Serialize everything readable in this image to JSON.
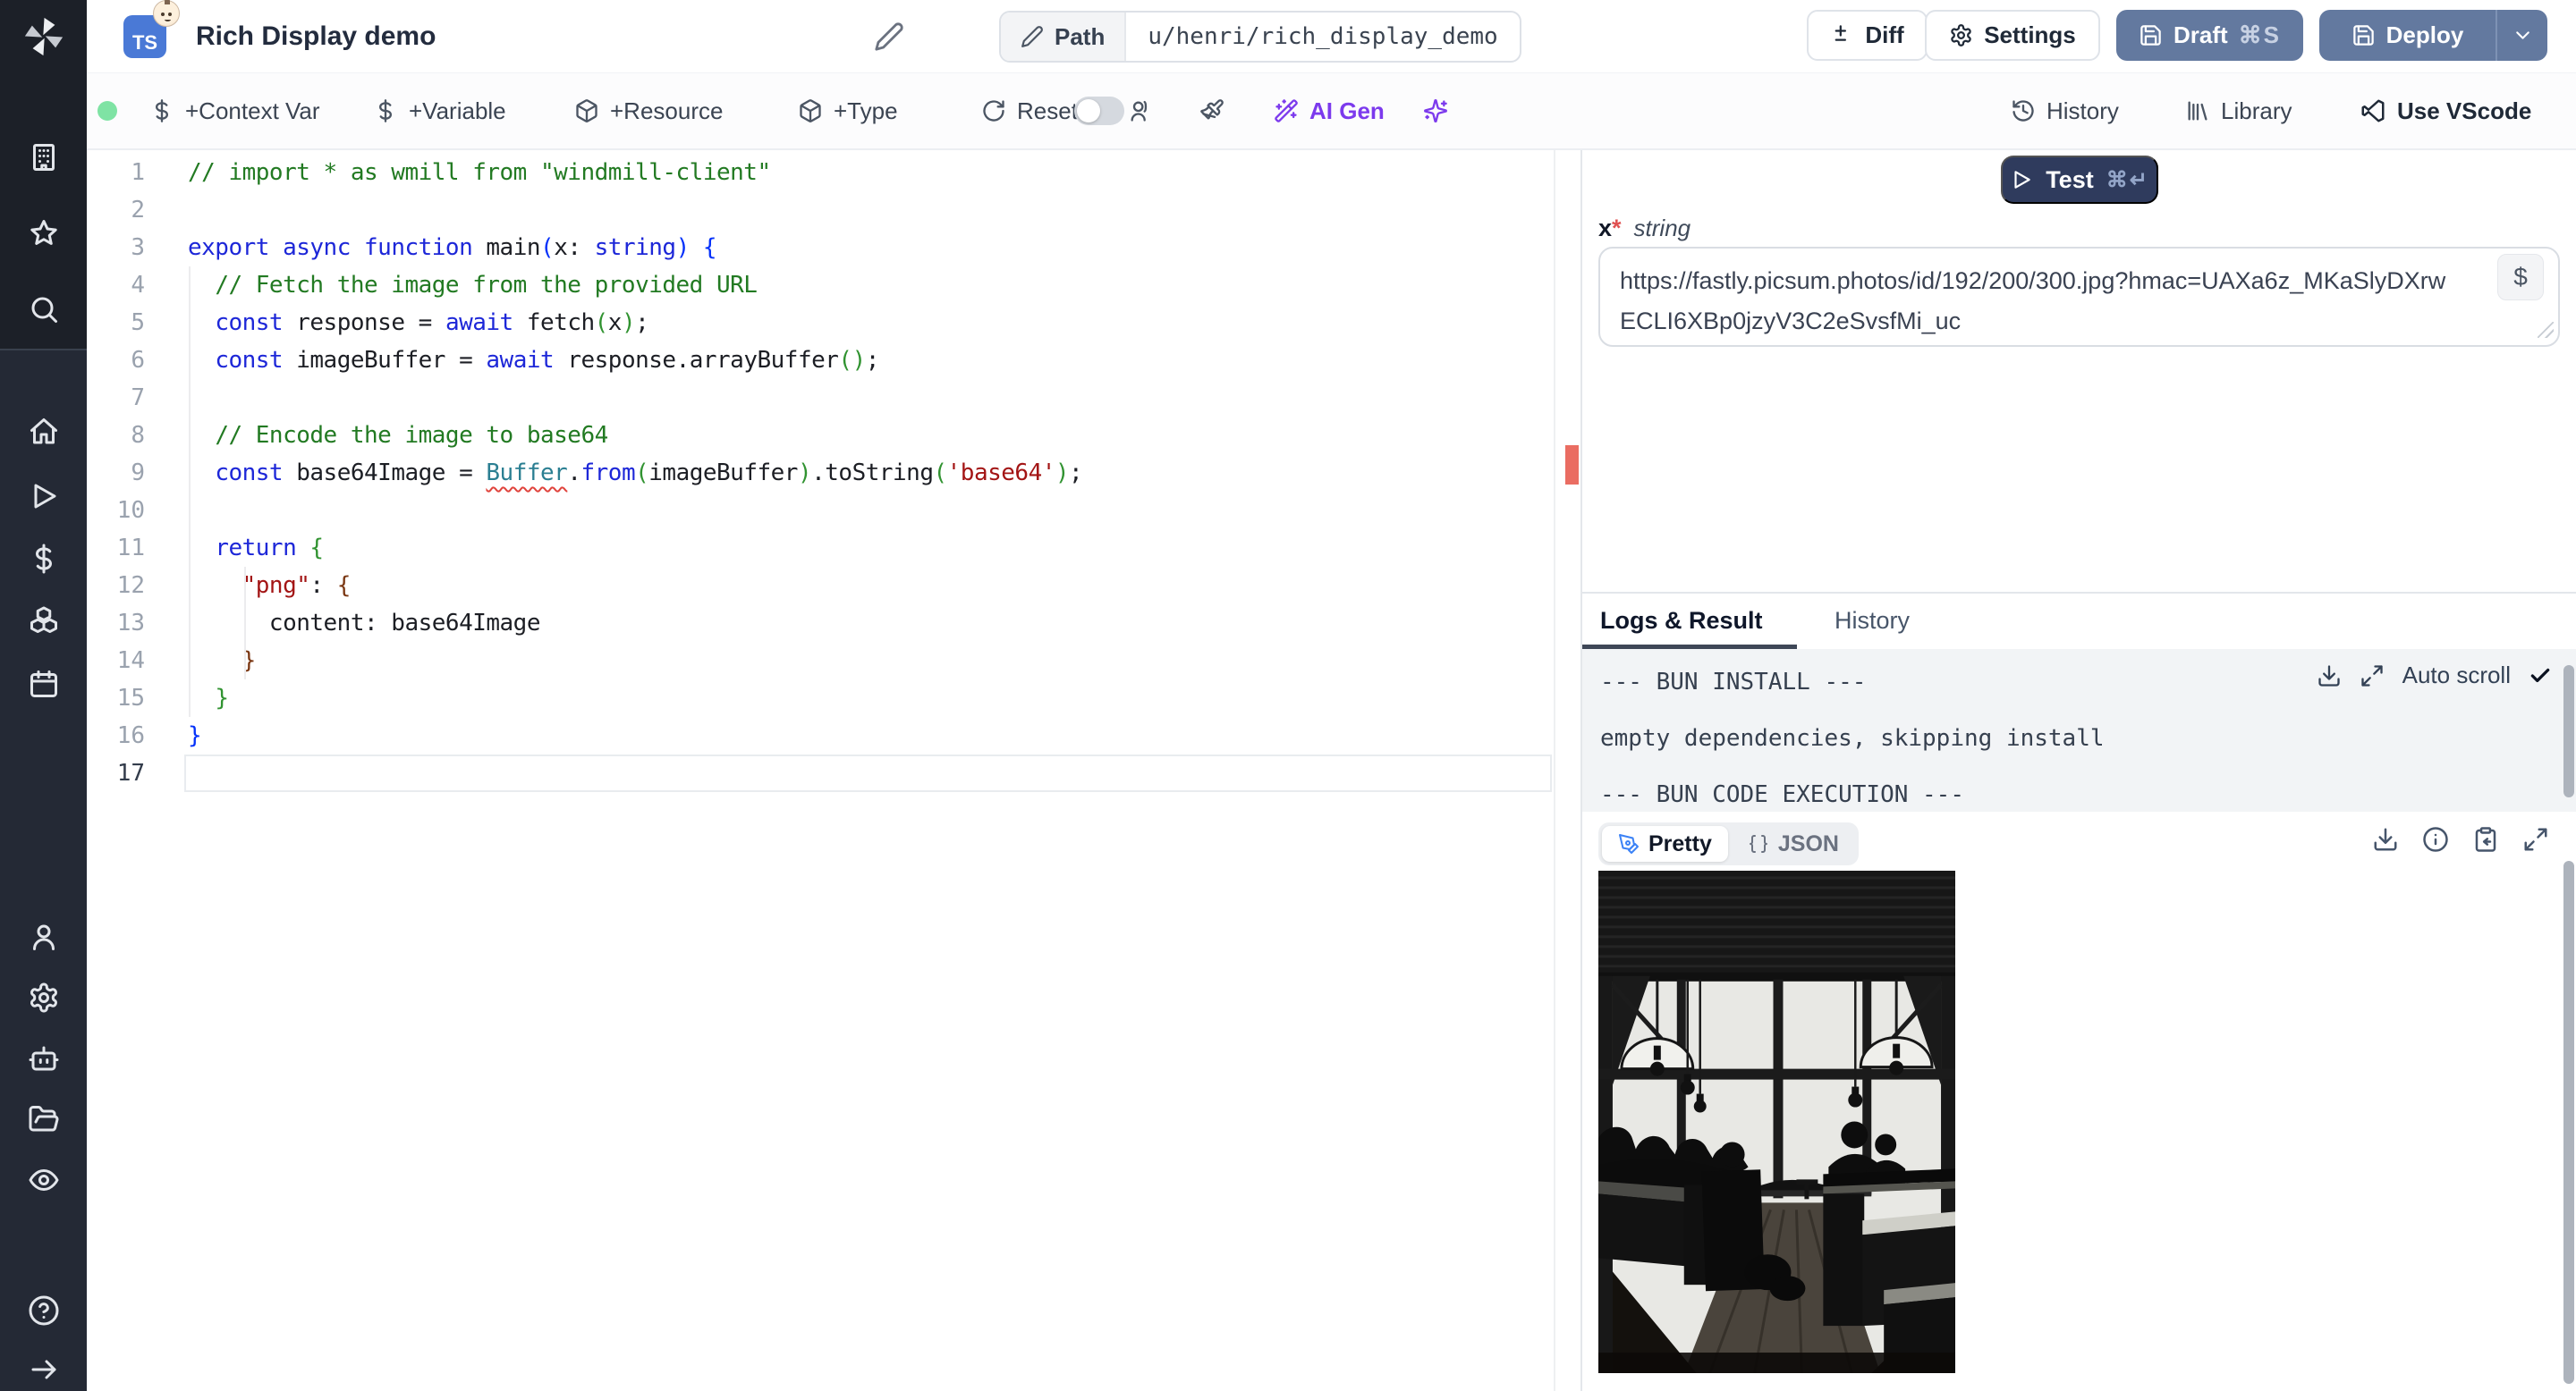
{
  "header": {
    "badge": "TS",
    "title": "Rich Display demo",
    "path_label": "Path",
    "path_value": "u/henri/rich_display_demo",
    "diff": "Diff",
    "settings": "Settings",
    "draft": "Draft",
    "draft_kbd": "⌘S",
    "deploy": "Deploy"
  },
  "toolbar": {
    "status_dot_color": "#7fe3a4",
    "context_var": "+Context Var",
    "variable": "+Variable",
    "resource": "+Resource",
    "type": "+Type",
    "reset": "Reset",
    "ai_gen": "AI Gen",
    "history": "History",
    "library": "Library",
    "vscode": "Use VScode",
    "accent_purple": "#7c3aed"
  },
  "sidebar": {
    "top_icons": [
      {
        "name": "building-icon",
        "icon": "building"
      },
      {
        "name": "star-icon",
        "icon": "star"
      },
      {
        "name": "search-icon",
        "icon": "search"
      }
    ],
    "mid_icons": [
      {
        "name": "home-icon",
        "icon": "home"
      },
      {
        "name": "runs-play-icon",
        "icon": "play"
      },
      {
        "name": "variables-dollar-icon",
        "icon": "dollar"
      },
      {
        "name": "resources-boxes-icon",
        "icon": "boxes"
      },
      {
        "name": "schedules-calendar-icon",
        "icon": "calendar"
      }
    ],
    "lower_icons": [
      {
        "name": "user-icon",
        "icon": "user"
      },
      {
        "name": "settings-gear-icon",
        "icon": "gear"
      },
      {
        "name": "workers-bot-icon",
        "icon": "bot"
      },
      {
        "name": "folders-icon",
        "icon": "folder"
      },
      {
        "name": "audit-eye-icon",
        "icon": "eye"
      }
    ],
    "footer_icons": [
      {
        "name": "help-icon",
        "icon": "help"
      },
      {
        "name": "expand-arrow-icon",
        "icon": "arrow-right"
      }
    ]
  },
  "editor": {
    "active_line": 17,
    "error_marker_color": "#ea6d62",
    "lines": [
      {
        "n": 1,
        "tokens": [
          [
            "cmt",
            "// import * as wmill from \"windmill-client\""
          ]
        ]
      },
      {
        "n": 2,
        "tokens": []
      },
      {
        "n": 3,
        "tokens": [
          [
            "kw",
            "export"
          ],
          [
            "pl",
            " "
          ],
          [
            "kw",
            "async"
          ],
          [
            "pl",
            " "
          ],
          [
            "kw",
            "function"
          ],
          [
            "pl",
            " main"
          ],
          [
            "b0",
            "("
          ],
          [
            "pl",
            "x: "
          ],
          [
            "kw",
            "string"
          ],
          [
            "b0",
            ")"
          ],
          [
            "pl",
            " "
          ],
          [
            "b0",
            "{"
          ]
        ]
      },
      {
        "n": 4,
        "tokens": [
          [
            "pl",
            "  "
          ],
          [
            "cmt",
            "// Fetch the image from the provided URL"
          ]
        ]
      },
      {
        "n": 5,
        "tokens": [
          [
            "pl",
            "  "
          ],
          [
            "kw",
            "const"
          ],
          [
            "pl",
            " response = "
          ],
          [
            "kw",
            "await"
          ],
          [
            "pl",
            " fetch"
          ],
          [
            "b1",
            "("
          ],
          [
            "pl",
            "x"
          ],
          [
            "b1",
            ")"
          ],
          [
            "pl",
            ";"
          ]
        ]
      },
      {
        "n": 6,
        "tokens": [
          [
            "pl",
            "  "
          ],
          [
            "kw",
            "const"
          ],
          [
            "pl",
            " imageBuffer = "
          ],
          [
            "kw",
            "await"
          ],
          [
            "pl",
            " response.arrayBuffer"
          ],
          [
            "b1",
            "("
          ],
          [
            "b1",
            ")"
          ],
          [
            "pl",
            ";"
          ]
        ]
      },
      {
        "n": 7,
        "tokens": []
      },
      {
        "n": 8,
        "tokens": [
          [
            "pl",
            "  "
          ],
          [
            "cmt",
            "// Encode the image to base64"
          ]
        ]
      },
      {
        "n": 9,
        "tokens": [
          [
            "pl",
            "  "
          ],
          [
            "kw",
            "const"
          ],
          [
            "pl",
            " base64Image = "
          ],
          [
            "sq",
            "Buffer"
          ],
          [
            "pl",
            "."
          ],
          [
            "kw",
            "from"
          ],
          [
            "b1",
            "("
          ],
          [
            "pl",
            "imageBuffer"
          ],
          [
            "b1",
            ")"
          ],
          [
            "pl",
            ".toString"
          ],
          [
            "b1",
            "("
          ],
          [
            "str",
            "'base64'"
          ],
          [
            "b1",
            ")"
          ],
          [
            "pl",
            ";"
          ]
        ]
      },
      {
        "n": 10,
        "tokens": []
      },
      {
        "n": 11,
        "tokens": [
          [
            "pl",
            "  "
          ],
          [
            "kw",
            "return"
          ],
          [
            "pl",
            " "
          ],
          [
            "b1",
            "{"
          ]
        ]
      },
      {
        "n": 12,
        "tokens": [
          [
            "pl",
            "    "
          ],
          [
            "str",
            "\"png\""
          ],
          [
            "pl",
            ": "
          ],
          [
            "b2",
            "{"
          ]
        ]
      },
      {
        "n": 13,
        "tokens": [
          [
            "pl",
            "      content: base64Image"
          ]
        ]
      },
      {
        "n": 14,
        "tokens": [
          [
            "pl",
            "    "
          ],
          [
            "b2",
            "}"
          ]
        ]
      },
      {
        "n": 15,
        "tokens": [
          [
            "pl",
            "  "
          ],
          [
            "b1",
            "}"
          ]
        ]
      },
      {
        "n": 16,
        "tokens": [
          [
            "b0",
            "}"
          ]
        ]
      },
      {
        "n": 17,
        "tokens": []
      }
    ]
  },
  "panel": {
    "test": "Test",
    "test_kbd": "⌘↵",
    "arg": {
      "name": "x",
      "required_mark": "*",
      "type": "string",
      "value": "https://fastly.picsum.photos/id/192/200/300.jpg?hmac=UAXa6z_MKaSlyDXrwECLI6XBp0jzyV3C2eSvsfMi_uc",
      "dollar": "$"
    },
    "tabs": {
      "logs": "Logs & Result",
      "history": "History"
    },
    "auto_scroll": "Auto scroll",
    "logs": [
      "--- BUN INSTALL ---",
      "empty dependencies, skipping install",
      "--- BUN CODE EXECUTION ---"
    ],
    "result": {
      "pretty": "Pretty",
      "json": "JSON",
      "image_description": "Black and white photo of people silhouetted at tables in front of a large gridded window wall"
    }
  }
}
